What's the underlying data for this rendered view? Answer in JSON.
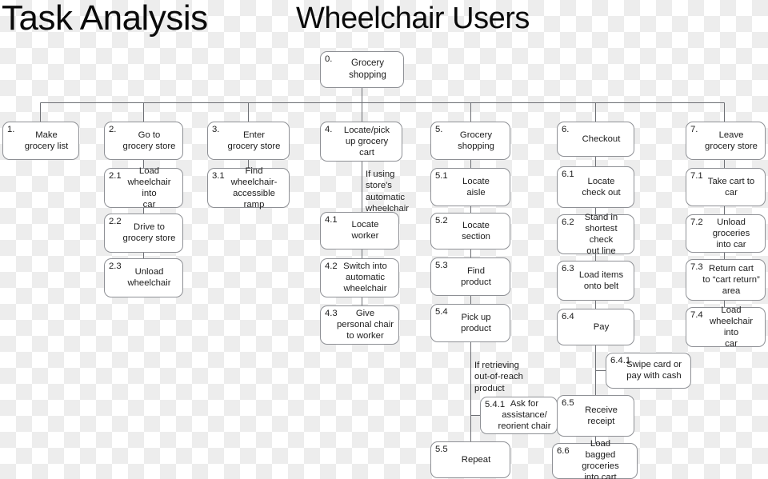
{
  "header": {
    "title": "Task Analysis",
    "subtitle": "Wheelchair Users"
  },
  "diagram": {
    "type": "hierarchical-task-analysis",
    "root": {
      "number": "0.",
      "label": "Grocery\nshopping"
    },
    "branches": [
      {
        "number": "1.",
        "label": "Make\ngrocery list",
        "subtasks": []
      },
      {
        "number": "2.",
        "label": "Go to\ngrocery store",
        "subtasks": [
          {
            "number": "2.1",
            "label": "Load\nwheelchair into\ncar"
          },
          {
            "number": "2.2",
            "label": "Drive to\ngrocery store"
          },
          {
            "number": "2.3",
            "label": "Unload\nwheelchair"
          }
        ]
      },
      {
        "number": "3.",
        "label": "Enter\ngrocery store",
        "subtasks": [
          {
            "number": "3.1",
            "label": "Find\nwheelchair-\naccessible ramp"
          }
        ]
      },
      {
        "number": "4.",
        "label": "Locate/pick\nup grocery\ncart",
        "condition": "If using\nstore's\nautomatic\nwheelchair",
        "subtasks": [
          {
            "number": "4.1",
            "label": "Locate\nworker"
          },
          {
            "number": "4.2",
            "label": "Switch into\nautomatic\nwheelchair"
          },
          {
            "number": "4.3",
            "label": "Give\npersonal chair\nto worker"
          }
        ]
      },
      {
        "number": "5.",
        "label": "Grocery\nshopping",
        "condition": "If retrieving\nout-of-reach\nproduct",
        "subtasks": [
          {
            "number": "5.1",
            "label": "Locate\naisle"
          },
          {
            "number": "5.2",
            "label": "Locate\nsection"
          },
          {
            "number": "5.3",
            "label": "Find\nproduct"
          },
          {
            "number": "5.4",
            "label": "Pick up\nproduct"
          },
          {
            "number": "5.4.1",
            "label": "Ask for\nassistance/\nreorient chair"
          },
          {
            "number": "5.5",
            "label": "Repeat"
          }
        ]
      },
      {
        "number": "6.",
        "label": "Checkout",
        "subtasks": [
          {
            "number": "6.1",
            "label": "Locate\ncheck out"
          },
          {
            "number": "6.2",
            "label": "Stand in\nshortest check\nout line"
          },
          {
            "number": "6.3",
            "label": "Load items\nonto belt"
          },
          {
            "number": "6.4",
            "label": "Pay"
          },
          {
            "number": "6.4.1",
            "label": "Swipe card or\npay with cash"
          },
          {
            "number": "6.5",
            "label": "Receive\nreceipt"
          },
          {
            "number": "6.6",
            "label": "Load\nbagged groceries\ninto cart"
          }
        ]
      },
      {
        "number": "7.",
        "label": "Leave\ngrocery store",
        "subtasks": [
          {
            "number": "7.1",
            "label": "Take cart to\ncar"
          },
          {
            "number": "7.2",
            "label": "Unload\ngroceries\ninto car"
          },
          {
            "number": "7.3",
            "label": "Return cart\nto “cart return”\narea"
          },
          {
            "number": "7.4",
            "label": "Load\nwheelchair into\ncar"
          }
        ]
      }
    ]
  },
  "colors": {
    "node_border": "#8e9095",
    "node_fill": "#ffffff",
    "connector": "#6d6f74",
    "text": "#1c1c1c",
    "title": "#0b0b0b",
    "checker": "#ededed"
  }
}
